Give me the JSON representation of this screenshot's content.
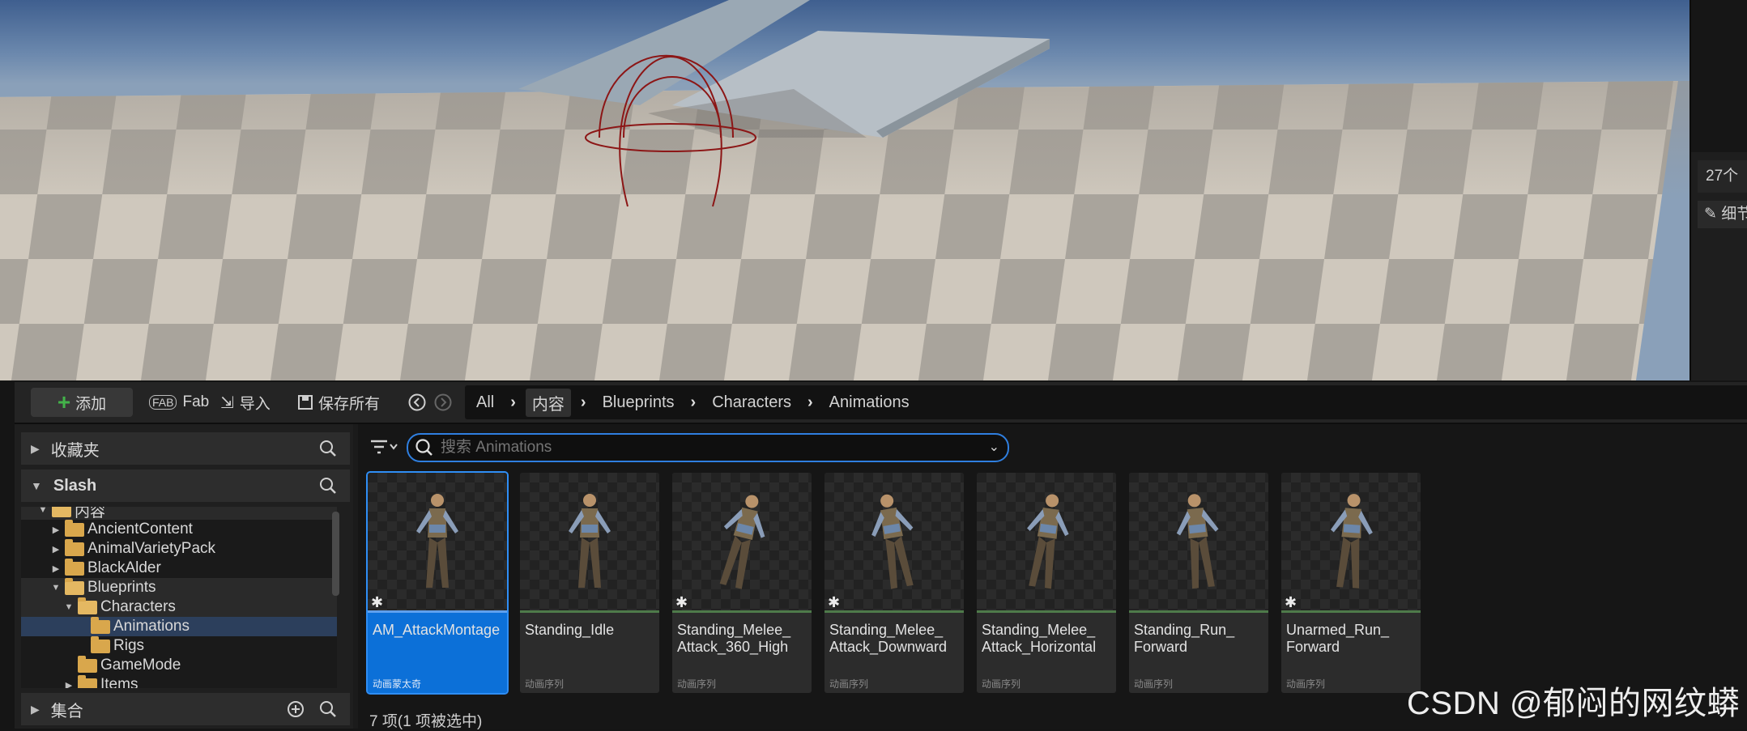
{
  "viewport": {
    "name": "level-viewport"
  },
  "right_panel": {
    "count": "27个",
    "detail": "细节"
  },
  "toolbar": {
    "add_label": "添加",
    "fab_label": "Fab",
    "import_label": "导入",
    "save_all_label": "保存所有"
  },
  "breadcrumb": [
    "All",
    "内容",
    "Blueprints",
    "Characters",
    "Animations"
  ],
  "left_panel": {
    "favorites_label": "收藏夹",
    "project_label": "Slash",
    "collections_label": "集合",
    "tree": [
      {
        "label": "内容",
        "depth": 1,
        "expanded": true
      },
      {
        "label": "AncientContent",
        "depth": 2,
        "expanded": false
      },
      {
        "label": "AnimalVarietyPack",
        "depth": 2,
        "expanded": false
      },
      {
        "label": "BlackAlder",
        "depth": 2,
        "expanded": false
      },
      {
        "label": "Blueprints",
        "depth": 2,
        "expanded": true
      },
      {
        "label": "Characters",
        "depth": 3,
        "expanded": true
      },
      {
        "label": "Animations",
        "depth": 4,
        "selected": true
      },
      {
        "label": "Rigs",
        "depth": 4
      },
      {
        "label": "GameMode",
        "depth": 3
      },
      {
        "label": "Items",
        "depth": 3,
        "expanded": false
      }
    ]
  },
  "search": {
    "placeholder": "搜索 Animations"
  },
  "assets": [
    {
      "name": "AM_AttackMontage",
      "type": "动画蒙太奇",
      "selected": true,
      "star": true
    },
    {
      "name": "Standing_Idle",
      "type": "动画序列",
      "selected": false,
      "star": false
    },
    {
      "name": "Standing_Melee_ Attack_360_High",
      "type": "动画序列",
      "selected": false,
      "star": true
    },
    {
      "name": "Standing_Melee_ Attack_Downward",
      "type": "动画序列",
      "selected": false,
      "star": true
    },
    {
      "name": "Standing_Melee_ Attack_Horizontal",
      "type": "动画序列",
      "selected": false,
      "star": false
    },
    {
      "name": "Standing_Run_ Forward",
      "type": "动画序列",
      "selected": false,
      "star": false
    },
    {
      "name": "Unarmed_Run_ Forward",
      "type": "动画序列",
      "selected": false,
      "star": true
    }
  ],
  "status": "7 项(1 项被选中)",
  "watermark": "CSDN @郁闷的网纹蟒",
  "colors": {
    "accent": "#0c70d8",
    "add_icon": "#43b34a",
    "folder": "#d9a74c"
  }
}
